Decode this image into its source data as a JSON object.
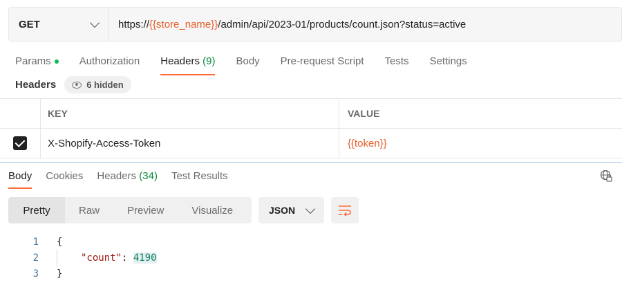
{
  "request": {
    "method": "GET",
    "url_prefix": "https://",
    "url_variable": "{{store_name}}",
    "url_suffix": "/admin/api/2023-01/products/count.json?status=active"
  },
  "request_tabs": {
    "params": "Params",
    "authorization": "Authorization",
    "headers": "Headers",
    "headers_count": "(9)",
    "body": "Body",
    "prerequest": "Pre-request Script",
    "tests": "Tests",
    "settings": "Settings"
  },
  "headers_section": {
    "label": "Headers",
    "hidden_label": "6 hidden"
  },
  "table": {
    "columns": {
      "key": "KEY",
      "value": "VALUE"
    },
    "rows": [
      {
        "key": "X-Shopify-Access-Token",
        "value": "{{token}}",
        "checked": true
      }
    ]
  },
  "response_tabs": {
    "body": "Body",
    "cookies": "Cookies",
    "headers": "Headers",
    "headers_count": "(34)",
    "test_results": "Test Results"
  },
  "view_modes": {
    "pretty": "Pretty",
    "raw": "Raw",
    "preview": "Preview",
    "visualize": "Visualize",
    "format": "JSON"
  },
  "code": {
    "line_numbers": [
      "1",
      "2",
      "3"
    ],
    "open_brace": "{",
    "key": "\"count\"",
    "colon": ": ",
    "value": "4190",
    "close_brace": "}"
  },
  "colors": {
    "accent": "#ff6c37",
    "variable": "#e8602c",
    "green": "#0cbb52"
  }
}
